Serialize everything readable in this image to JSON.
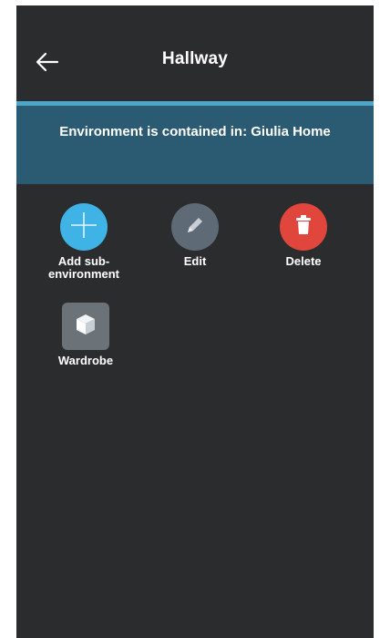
{
  "header": {
    "title": "Hallway",
    "back_icon": "arrow-left-icon"
  },
  "banner": {
    "text": "Environment is contained in: Giulia Home"
  },
  "actions": [
    {
      "label": "Add sub-\nenvironment",
      "icon": "plus-icon",
      "color": "#3fb3e6"
    },
    {
      "label": "Edit",
      "icon": "pencil-icon",
      "color": "#5e6b76"
    },
    {
      "label": "Delete",
      "icon": "trash-icon",
      "color": "#e0463c"
    }
  ],
  "items": [
    {
      "label": "Wardrobe",
      "icon": "wardrobe-cube-icon"
    }
  ],
  "colors": {
    "background": "#2b2c2e",
    "banner": "#2b5a73",
    "banner_border": "#4ba6c9"
  }
}
